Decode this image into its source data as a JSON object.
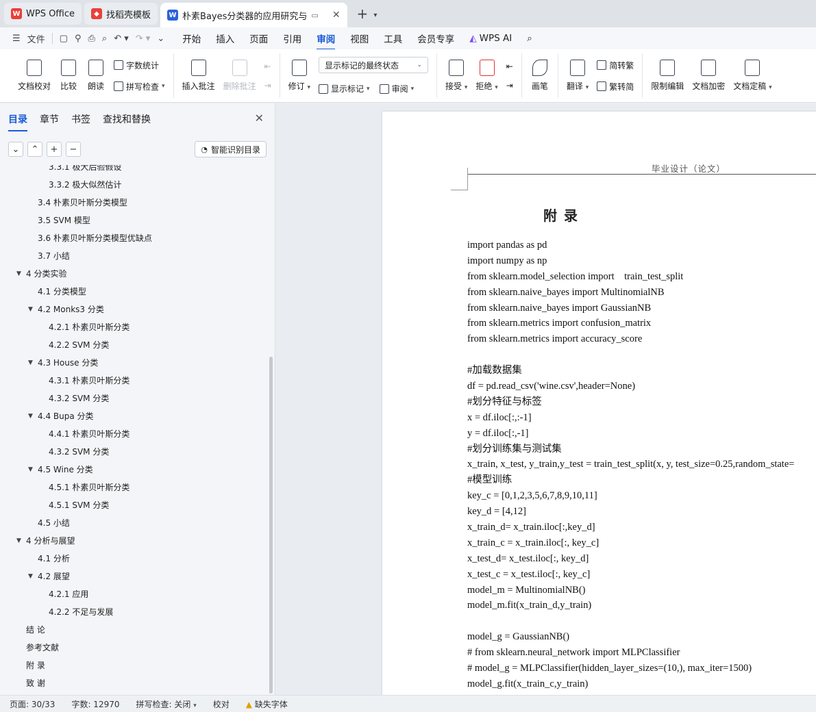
{
  "tabs": [
    {
      "label": "WPS Office",
      "logo": "W",
      "color": "#e8403a"
    },
    {
      "label": "找稻壳模板",
      "logo": "◆",
      "color": "#e8403a"
    },
    {
      "label": "朴素Bayes分类器的应用研究与",
      "logo": "W",
      "color": "#2b62d8",
      "active": true
    }
  ],
  "menubar": {
    "file": "文件",
    "items": [
      "开始",
      "插入",
      "页面",
      "引用",
      "审阅",
      "视图",
      "工具",
      "会员专享"
    ],
    "active": "审阅",
    "ai": "WPS AI"
  },
  "ribbon": {
    "doc_check": "文档校对",
    "compare": "比较",
    "read": "朗读",
    "word_count": "字数统计",
    "spell_check": "拼写检查",
    "insert_comment": "插入批注",
    "delete_comment": "删除批注",
    "revise": "修订",
    "markup_state": "显示标记的最终状态",
    "show_markup": "显示标记",
    "review": "审阅",
    "accept": "接受",
    "reject": "拒绝",
    "pen": "画笔",
    "translate": "翻译",
    "to_traditional": "简转繁",
    "to_simplified": "繁转简",
    "restrict_edit": "限制编辑",
    "encrypt": "文档加密",
    "finalize": "文档定稿"
  },
  "panel": {
    "tabs": [
      "目录",
      "章节",
      "书签",
      "查找和替换"
    ],
    "smart_toc": "智能识别目录",
    "toc": [
      {
        "label": "3.3.1  极大后验假设",
        "level": 3
      },
      {
        "label": "3.3.2  极大似然估计",
        "level": 3
      },
      {
        "label": "3.4  朴素贝叶斯分类模型",
        "level": 2
      },
      {
        "label": "3.5 SVM 模型",
        "level": 2
      },
      {
        "label": "3.6 朴素贝叶斯分类模型优缺点",
        "level": 2
      },
      {
        "label": "3.7  小结",
        "level": 2
      },
      {
        "label": "4  分类实验",
        "level": 1,
        "expanded": true
      },
      {
        "label": "4.1 分类模型",
        "level": 2
      },
      {
        "label": "4.2 Monks3 分类",
        "level": 2,
        "expanded": true
      },
      {
        "label": "4.2.1  朴素贝叶斯分类",
        "level": 3
      },
      {
        "label": "4.2.2 SVM 分类",
        "level": 3
      },
      {
        "label": "4.3 House 分类",
        "level": 2,
        "expanded": true
      },
      {
        "label": "4.3.1  朴素贝叶斯分类",
        "level": 3
      },
      {
        "label": "4.3.2 SVM 分类",
        "level": 3
      },
      {
        "label": "4.4 Bupa 分类",
        "level": 2,
        "expanded": true
      },
      {
        "label": "4.4.1  朴素贝叶斯分类",
        "level": 3
      },
      {
        "label": "4.3.2 SVM 分类",
        "level": 3
      },
      {
        "label": "4.5 Wine 分类",
        "level": 2,
        "expanded": true
      },
      {
        "label": "4.5.1  朴素贝叶斯分类",
        "level": 3
      },
      {
        "label": "4.5.1 SVM 分类",
        "level": 3
      },
      {
        "label": "4.5  小结",
        "level": 2
      },
      {
        "label": "4  分析与展望",
        "level": 1,
        "expanded": true
      },
      {
        "label": "4.1  分析",
        "level": 2
      },
      {
        "label": "4.2  展望",
        "level": 2,
        "expanded": true
      },
      {
        "label": "4.2.1  应用",
        "level": 3
      },
      {
        "label": "4.2.2  不足与发展",
        "level": 3
      },
      {
        "label": "结  论",
        "level": 1
      },
      {
        "label": "参考文献",
        "level": 1
      },
      {
        "label": "附  录",
        "level": 1
      },
      {
        "label": "致  谢",
        "level": 1
      }
    ]
  },
  "document": {
    "header": "毕业设计（论文）",
    "title": "附录",
    "code_lines": [
      "import pandas as pd",
      "import numpy as np",
      "from sklearn.model_selection import    train_test_split",
      "from sklearn.naive_bayes import MultinomialNB",
      "from sklearn.naive_bayes import GaussianNB",
      "from sklearn.metrics import confusion_matrix",
      "from sklearn.metrics import accuracy_score",
      "",
      "#加载数据集",
      "df = pd.read_csv('wine.csv',header=None)",
      "#划分特征与标签",
      "x = df.iloc[:,:-1]",
      "y = df.iloc[:,-1]",
      "#划分训练集与测试集",
      "x_train, x_test, y_train,y_test = train_test_split(x, y, test_size=0.25,random_state=",
      "#模型训练",
      "key_c = [0,1,2,3,5,6,7,8,9,10,11]",
      "key_d = [4,12]",
      "x_train_d= x_train.iloc[:,key_d]",
      "x_train_c = x_train.iloc[:, key_c]",
      "x_test_d= x_test.iloc[:, key_d]",
      "x_test_c = x_test.iloc[:, key_c]",
      "model_m = MultinomialNB()",
      "model_m.fit(x_train_d,y_train)",
      "",
      "model_g = GaussianNB()",
      "# from sklearn.neural_network import MLPClassifier",
      "# model_g = MLPClassifier(hidden_layer_sizes=(10,), max_iter=1500)",
      "model_g.fit(x_train_c,y_train)"
    ]
  },
  "status": {
    "page": "页面: 30/33",
    "words": "字数: 12970",
    "spell": "拼写检查: 关闭",
    "proof": "校对",
    "missing_font": "缺失字体"
  }
}
